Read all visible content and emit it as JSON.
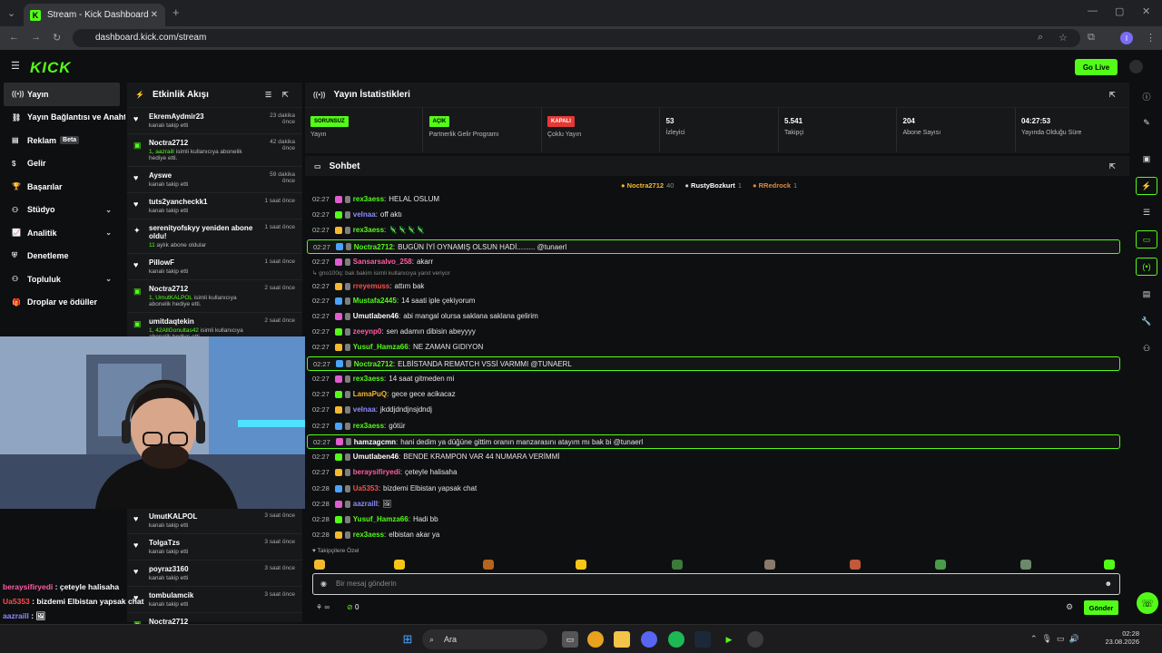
{
  "browser": {
    "tab_title": "Stream - Kick Dashboard",
    "url": "dashboard.kick.com/stream",
    "profile_initial": "I"
  },
  "header": {
    "logo": "KICK",
    "go_live": "Go Live"
  },
  "sidebar": {
    "items": [
      {
        "label": "Yayın",
        "icon": "broadcast-icon"
      },
      {
        "label": "Yayın Bağlantısı ve Anahtarı",
        "icon": "link-icon"
      },
      {
        "label": "Reklam",
        "badge": "Beta",
        "icon": "ad-icon"
      },
      {
        "label": "Gelir",
        "icon": "dollar-icon"
      },
      {
        "label": "Başarılar",
        "icon": "trophy-icon"
      },
      {
        "label": "Stüdyo",
        "icon": "studio-icon"
      },
      {
        "label": "Analitik",
        "icon": "chart-icon"
      },
      {
        "label": "Denetleme",
        "icon": "shield-icon"
      },
      {
        "label": "Topluluk",
        "icon": "users-icon"
      },
      {
        "label": "Droplar ve ödüller",
        "icon": "gift-icon"
      }
    ]
  },
  "activity": {
    "title": "Etkinlik Akışı",
    "items": [
      {
        "name": "EkremAydmir23",
        "sub": "kanalı takip etti",
        "time": "23 dakika önce",
        "icon": "heart-icon"
      },
      {
        "name": "Noctra2712",
        "sub_hl": "1, aazraill",
        "sub": " isimli kullanıcıya abonelik hediye etti.",
        "time": "42 dakika önce",
        "icon": "gift-icon"
      },
      {
        "name": "Ayswe",
        "sub": "kanalı takip etti",
        "time": "59 dakika önce",
        "icon": "heart-icon"
      },
      {
        "name": "tuts2yancheckk1",
        "sub": "kanalı takip etti",
        "time": "1 saat önce",
        "icon": "heart-icon"
      },
      {
        "name": "serenityofskyy yeniden abone oldu!",
        "sub_hl": "11",
        "sub": " aylık abone oldular",
        "time": "1 saat önce",
        "icon": "star-icon"
      },
      {
        "name": "PillowF",
        "sub": "kanalı takip etti",
        "time": "1 saat önce",
        "icon": "heart-icon"
      },
      {
        "name": "Noctra2712",
        "sub_hl": "1, UmutKALPOL",
        "sub": " isimli kullanıcıya abonelik hediye etti.",
        "time": "2 saat önce",
        "icon": "gift-icon"
      },
      {
        "name": "umitdaqtekin",
        "sub_hl": "1, 42AllGonultas42",
        "sub": " isimli kullanıcıya abonelik hediye etti.",
        "time": "2 saat önce",
        "icon": "gift-icon"
      }
    ],
    "items_bottom": [
      {
        "name": "UmutKALPOL",
        "sub": "kanalı takip etti",
        "time": "3 saat önce",
        "icon": "heart-icon"
      },
      {
        "name": "TolgaTzs",
        "sub": "kanalı takip etti",
        "time": "3 saat önce",
        "icon": "heart-icon"
      },
      {
        "name": "poyraz3160",
        "sub": "kanalı takip etti",
        "time": "3 saat önce",
        "icon": "heart-icon"
      },
      {
        "name": "tombulamcik",
        "sub": "kanalı takip etti",
        "time": "3 saat önce",
        "icon": "heart-icon"
      },
      {
        "name": "Noctra2712",
        "sub": "",
        "time": "",
        "icon": "gift-icon"
      }
    ]
  },
  "stats": {
    "title": "Yayın İstatistikleri",
    "cells": [
      {
        "tag": "SORUNSUZ",
        "tag_color": "#53fc18",
        "label": "Yayın"
      },
      {
        "tag": "AÇIK",
        "tag_color": "#53fc18",
        "label": "Partnerlik Gelir Programı"
      },
      {
        "tag": "KAPALI",
        "tag_color": "#e53935",
        "label": "Çoklu Yayın"
      },
      {
        "value": "53",
        "label": "İzleyici"
      },
      {
        "value": "5.541",
        "label": "Takipçi"
      },
      {
        "value": "204",
        "label": "Abone Sayısı"
      },
      {
        "value": "04:27:53",
        "label": "Yayında Olduğu Süre"
      }
    ]
  },
  "chat": {
    "title": "Sohbet",
    "top": [
      {
        "name": "Noctra2712",
        "n": "40",
        "color": "#f5b82e"
      },
      {
        "name": "RustyBozkurt",
        "n": "1",
        "color": "#cfcfcf"
      },
      {
        "name": "RRedrock",
        "n": "1",
        "color": "#e0883a"
      }
    ],
    "messages": [
      {
        "t": "02:27",
        "u": "rex3aess",
        "c": "#53fc18",
        "m": "HELAL OSLUM"
      },
      {
        "t": "02:27",
        "u": "velnaa",
        "c": "#8b8cff",
        "m": "off aktı"
      },
      {
        "t": "02:27",
        "u": "rex3aess",
        "c": "#53fc18",
        "m": "🦎🦎🦎🦎"
      },
      {
        "t": "02:27",
        "u": "Noctra2712",
        "c": "#53fc18",
        "m": "BUGÜN İYİ OYNAMIŞ OLSUN HADİ......... @tunaerl",
        "hl": true
      },
      {
        "t": "02:27",
        "u": "Sansarsalvo_258",
        "c": "#ff5ca8",
        "m": "akarr"
      },
      {
        "t": "",
        "u": "",
        "c": "#888",
        "m": "↳ gno100q: bak bakim isimli kullanıcıya yanıt veriyor",
        "reply": true
      },
      {
        "t": "02:27",
        "u": "rreyemuss",
        "c": "#ff4d4d",
        "m": "attım bak"
      },
      {
        "t": "02:27",
        "u": "Mustafa2445",
        "c": "#53fc18",
        "m": "14 saati iple çekiyorum"
      },
      {
        "t": "02:27",
        "u": "Umutlaben46",
        "c": "#ffffff",
        "m": "abi mangal olursa saklana saklana gelirim"
      },
      {
        "t": "02:27",
        "u": "zeeynp0",
        "c": "#ff5ca8",
        "m": "sen adamın dibisin abeyyyy"
      },
      {
        "t": "02:27",
        "u": "Yusuf_Hamza66",
        "c": "#53fc18",
        "m": "NE ZAMAN GIDIYON"
      },
      {
        "t": "02:27",
        "u": "Noctra2712",
        "c": "#53fc18",
        "m": "ELBİSTANDA REMATCH VSSİ VARMMI @TUNAERL",
        "hl": true
      },
      {
        "t": "02:27",
        "u": "rex3aess",
        "c": "#53fc18",
        "m": "14 saat gitmeden mi"
      },
      {
        "t": "02:27",
        "u": "LamaPuQ",
        "c": "#f5b82e",
        "m": "gece gece acikacaz"
      },
      {
        "t": "02:27",
        "u": "velnaa",
        "c": "#8b8cff",
        "m": "jkddjdndjnsjdndj"
      },
      {
        "t": "02:27",
        "u": "rex3aess",
        "c": "#53fc18",
        "m": "götür"
      },
      {
        "t": "02:27",
        "u": "hamzagcmn",
        "c": "#ffffff",
        "m": "hani dedim ya düğüne gittim oranın manzarasını atayım mı bak bi @tunaerl",
        "hl": true
      },
      {
        "t": "02:27",
        "u": "Umutlaben46",
        "c": "#ffffff",
        "m": "BENDE KRAMPON VAR 44 NUMARA VERİMMİ"
      },
      {
        "t": "02:27",
        "u": "beraysifiryedi",
        "c": "#ff5ca8",
        "m": "çeteyle halisaha"
      },
      {
        "t": "02:28",
        "u": "Ua5353",
        "c": "#ff4d4d",
        "m": "bizdemi Elbistan yapsak chat"
      },
      {
        "t": "02:28",
        "u": "aazraill",
        "c": "#8b8cff",
        "m": "🖼"
      },
      {
        "t": "02:28",
        "u": "Yusuf_Hamza66",
        "c": "#53fc18",
        "m": "Hadi bb"
      },
      {
        "t": "02:28",
        "u": "rex3aess",
        "c": "#53fc18",
        "m": "elbistan akar ya"
      }
    ],
    "emote_label": "♥ Takipçilere Özel",
    "input_placeholder": "Bir mesaj gönderin",
    "send": "Gönder",
    "count": "0"
  },
  "overlay": [
    {
      "u": "beraysifiryedi",
      "c": "#ff5ca8",
      "m": "çeteyle halisaha"
    },
    {
      "u": "Ua5353",
      "c": "#ff4d4d",
      "m": "bizdemi Elbistan yapsak chat"
    },
    {
      "u": "aazraill",
      "c": "#8b8cff",
      "m": "🖼"
    },
    {
      "u": "Yusuf_Hamza66",
      "c": "#53fc18",
      "m": "Hadi bb"
    },
    {
      "u": "rex3aess",
      "c": "#53fc18",
      "m": "elbistan akar ya"
    }
  ],
  "taskbar": {
    "search": "Ara",
    "time": "02:28",
    "date": "23.08.2026"
  }
}
